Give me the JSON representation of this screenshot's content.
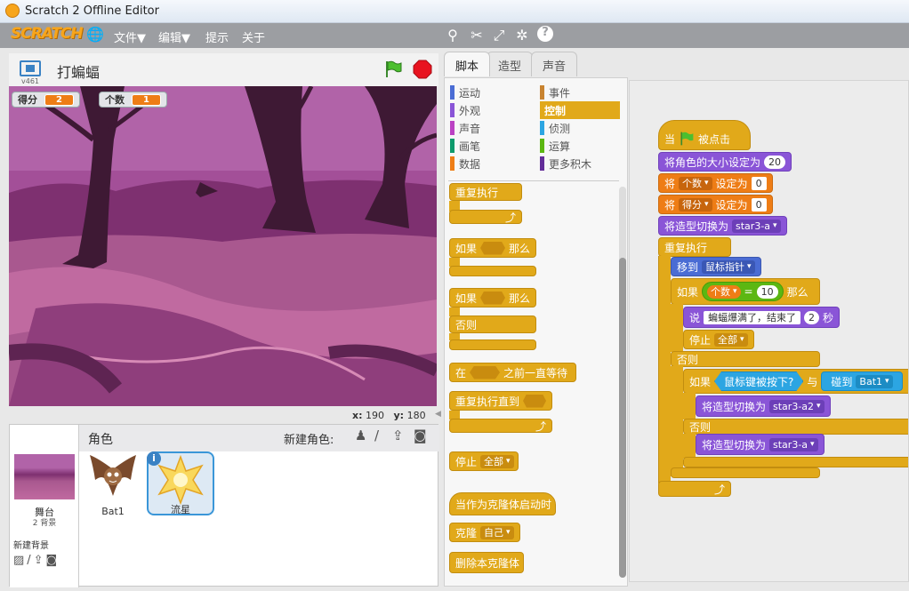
{
  "window": {
    "title": "Scratch 2 Offline Editor"
  },
  "menu": {
    "logo": "SCRATCH",
    "file": "文件▼",
    "edit": "编辑▼",
    "tips": "提示",
    "about": "关于"
  },
  "toolbar": {
    "icons": [
      "duplicate-icon",
      "cut-icon",
      "grow-icon",
      "shrink-icon",
      "help-icon"
    ]
  },
  "stage": {
    "version": "v461",
    "project_name": "打蝙蝠",
    "monitors": [
      {
        "label": "得分",
        "value": "2"
      },
      {
        "label": "个数",
        "value": "1"
      }
    ],
    "x_label": "x:",
    "x": "190",
    "y_label": "y:",
    "y": "180"
  },
  "sprites": {
    "header": "角色",
    "new_sprite": "新建角色:",
    "stage_label": "舞台",
    "stage_backdrops": "2 背景",
    "new_backdrop": "新建背景",
    "items": [
      {
        "name": "Bat1"
      },
      {
        "name": "流星"
      }
    ]
  },
  "tabs": [
    "脚本",
    "造型",
    "声音"
  ],
  "categories": {
    "left": [
      {
        "label": "运动",
        "color": "#4a6cd4"
      },
      {
        "label": "外观",
        "color": "#8a55d7"
      },
      {
        "label": "声音",
        "color": "#bb42c3"
      },
      {
        "label": "画笔",
        "color": "#0e9a6c"
      },
      {
        "label": "数据",
        "color": "#ee7d16"
      }
    ],
    "right": [
      {
        "label": "事件",
        "color": "#c88330"
      },
      {
        "label": "控制",
        "color": "#e1a91a"
      },
      {
        "label": "侦测",
        "color": "#2ca5e2"
      },
      {
        "label": "运算",
        "color": "#5cb712"
      },
      {
        "label": "更多积木",
        "color": "#632d99"
      }
    ]
  },
  "palette": {
    "forever": "重复执行",
    "if_label": "如果",
    "then": "那么",
    "else": "否则",
    "wait_until_1": "在",
    "wait_until_2": "之前一直等待",
    "repeat_until": "重复执行直到",
    "stop": "停止",
    "stop_all": "全部",
    "when_clone": "当作为克隆体启动时",
    "clone": "克隆",
    "clone_self": "自己",
    "delete_clone": "删除本克隆体"
  },
  "script": {
    "when": "当",
    "clicked": "被点击",
    "set_size": "将角色的大小设定为",
    "size": "20",
    "set": "将",
    "var1": "个数",
    "to": "设定为",
    "val1": "0",
    "var2": "得分",
    "val2": "0",
    "switch_costume": "将造型切换为",
    "costume1": "star3-a",
    "forever": "重复执行",
    "goto": "移到",
    "mouse_pointer": "鼠标指针",
    "if": "如果",
    "count": "个数",
    "eq": "=",
    "ten": "10",
    "then": "那么",
    "say": "说",
    "say_text": "蝙蝠爆满了，结束了",
    "secs": "2",
    "secs_label": "秒",
    "stop": "停止",
    "all": "全部",
    "else": "否则",
    "mouse_down": "鼠标键被按下?",
    "and": "与",
    "touching": "碰到",
    "bat1": "Bat1",
    "costume2": "star3-a2",
    "costume3": "star3-a"
  }
}
